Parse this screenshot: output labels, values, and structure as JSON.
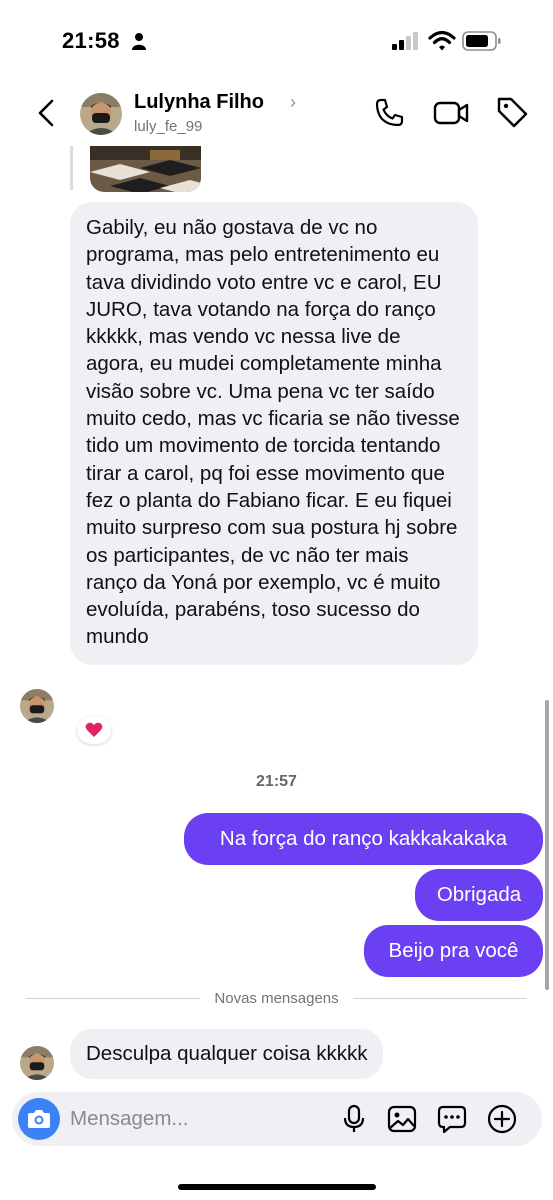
{
  "status_bar": {
    "time": "21:58"
  },
  "header": {
    "name": "Lulynha Filho",
    "chevron": "›",
    "username": "luly_fe_99",
    "icons": [
      "back-icon",
      "phone-icon",
      "video-icon",
      "tag-icon"
    ]
  },
  "conversation": {
    "long_message": "Gabily, eu não gostava de vc no programa, mas pelo entretenimento eu tava dividindo voto entre vc e carol, EU JURO, tava votando na força do ranço kkkkk, mas vendo vc nessa live de agora, eu mudei completamente minha visão sobre vc. Uma pena vc ter saído muito cedo, mas vc ficaria se não tivesse tido um movimento de torcida tentando tirar a carol, pq foi esse movimento que fez o planta do Fabiano ficar. E eu fiquei muito surpreso com sua postura hj sobre os participantes, de vc não ter mais ranço da Yoná por exemplo, vc é muito evoluída, parabéns, toso sucesso do mundo",
    "reaction": "❤️",
    "timestamp": "21:57",
    "outgoing": [
      "Na força do ranço kakkakakaka",
      "Obrigada",
      "Beijo pra você"
    ],
    "divider": "Novas mensagens",
    "last_message": "Desculpa qualquer coisa kkkkk"
  },
  "composer": {
    "placeholder": "Mensagem...",
    "icons": [
      "camera-icon",
      "microphone-icon",
      "gallery-icon",
      "sticker-icon",
      "plus-icon"
    ]
  },
  "colors": {
    "outgoing_bubble": "#6b3ff2",
    "incoming_bubble": "#efeff4",
    "camera_button": "#3b82f6",
    "reaction_heart": "#e0245e"
  }
}
